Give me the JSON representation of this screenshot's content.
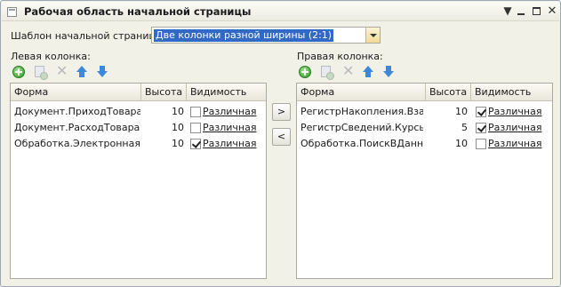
{
  "window": {
    "title": "Рабочая область начальной страницы",
    "controls": {
      "menu": "▼",
      "minimize": "",
      "maximize": "",
      "close": "✕"
    }
  },
  "template": {
    "label": "Шаблон начальной страницы:",
    "value": "Две колонки разной ширины (2:1)"
  },
  "left": {
    "label": "Левая колонка:",
    "headers": {
      "form": "Форма",
      "height": "Высота",
      "visibility": "Видимость"
    },
    "rows": [
      {
        "form": "Документ.ПриходТовара...",
        "height": "10",
        "visible": false,
        "visibility": "Различная"
      },
      {
        "form": "Документ.РасходТовара...",
        "height": "10",
        "visible": false,
        "visibility": "Различная"
      },
      {
        "form": "Обработка.Электронная...",
        "height": "10",
        "visible": true,
        "visibility": "Различная"
      }
    ]
  },
  "right": {
    "label": "Правая колонка:",
    "headers": {
      "form": "Форма",
      "height": "Высота",
      "visibility": "Видимость"
    },
    "rows": [
      {
        "form": "РегистрНакопления.Вза...",
        "height": "10",
        "visible": true,
        "visibility": "Различная"
      },
      {
        "form": "РегистрСведений.Курсы...",
        "height": "5",
        "visible": true,
        "visibility": "Различная"
      },
      {
        "form": "Обработка.ПоискВДанн...",
        "height": "10",
        "visible": false,
        "visibility": "Различная"
      }
    ]
  },
  "move": {
    "right_label": ">",
    "left_label": "<"
  },
  "toolbar_icons": [
    "add-icon",
    "copy-icon",
    "delete-icon",
    "move-up-icon",
    "move-down-icon"
  ],
  "colors": {
    "selection": "#3169c6",
    "icon_blue": "#3f87d8",
    "icon_green": "#2f9a2a"
  }
}
